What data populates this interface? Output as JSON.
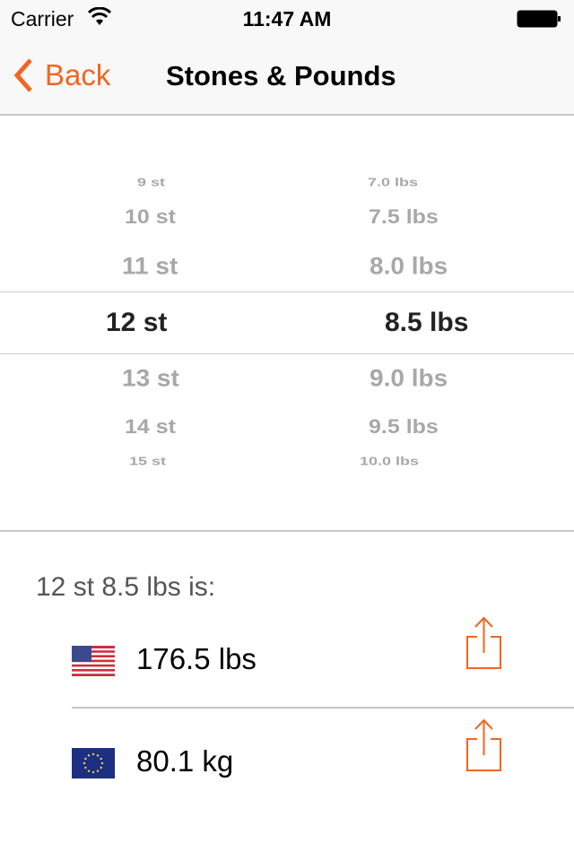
{
  "status_bar": {
    "carrier": "Carrier",
    "time": "11:47 AM"
  },
  "nav": {
    "back_label": "Back",
    "title": "Stones & Pounds"
  },
  "accent_color": "#f26522",
  "picker": {
    "stones": [
      "9 st",
      "10 st",
      "11 st",
      "12 st",
      "13 st",
      "14 st",
      "15 st"
    ],
    "pounds": [
      "7.0 lbs",
      "7.5 lbs",
      "8.0 lbs",
      "8.5 lbs",
      "9.0 lbs",
      "9.5 lbs",
      "10.0 lbs"
    ],
    "selected_stones": "12 st",
    "selected_pounds": "8.5 lbs"
  },
  "result": {
    "heading": "12 st 8.5 lbs is:",
    "rows": [
      {
        "flag": "us-flag-icon",
        "value": "176.5 lbs"
      },
      {
        "flag": "eu-flag-icon",
        "value": "80.1 kg"
      }
    ]
  }
}
